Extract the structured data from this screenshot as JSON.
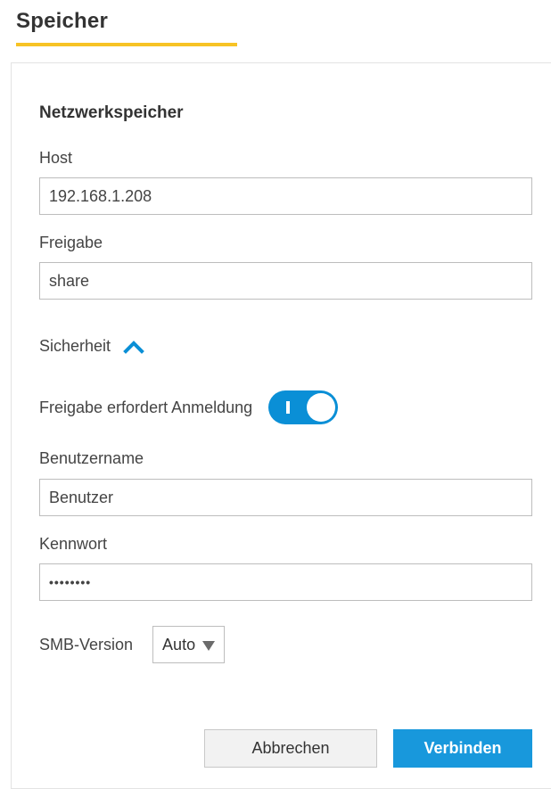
{
  "header": {
    "title": "Speicher"
  },
  "form": {
    "section_title": "Netzwerkspeicher",
    "host": {
      "label": "Host",
      "value": "192.168.1.208"
    },
    "share": {
      "label": "Freigabe",
      "value": "share"
    },
    "security": {
      "label": "Sicherheit",
      "expanded": true,
      "icon": "chevron-up-icon"
    },
    "login_required": {
      "label": "Freigabe erfordert Anmeldung",
      "enabled": true
    },
    "username": {
      "label": "Benutzername",
      "value": "Benutzer"
    },
    "password": {
      "label": "Kennwort",
      "value": "••••••••"
    },
    "smb_version": {
      "label": "SMB-Version",
      "selected": "Auto"
    }
  },
  "buttons": {
    "cancel_label": "Abbrechen",
    "connect_label": "Verbinden"
  },
  "colors": {
    "accent_underline": "#f7c325",
    "primary_blue": "#1898dc",
    "toggle_blue": "#0a8fd6"
  }
}
